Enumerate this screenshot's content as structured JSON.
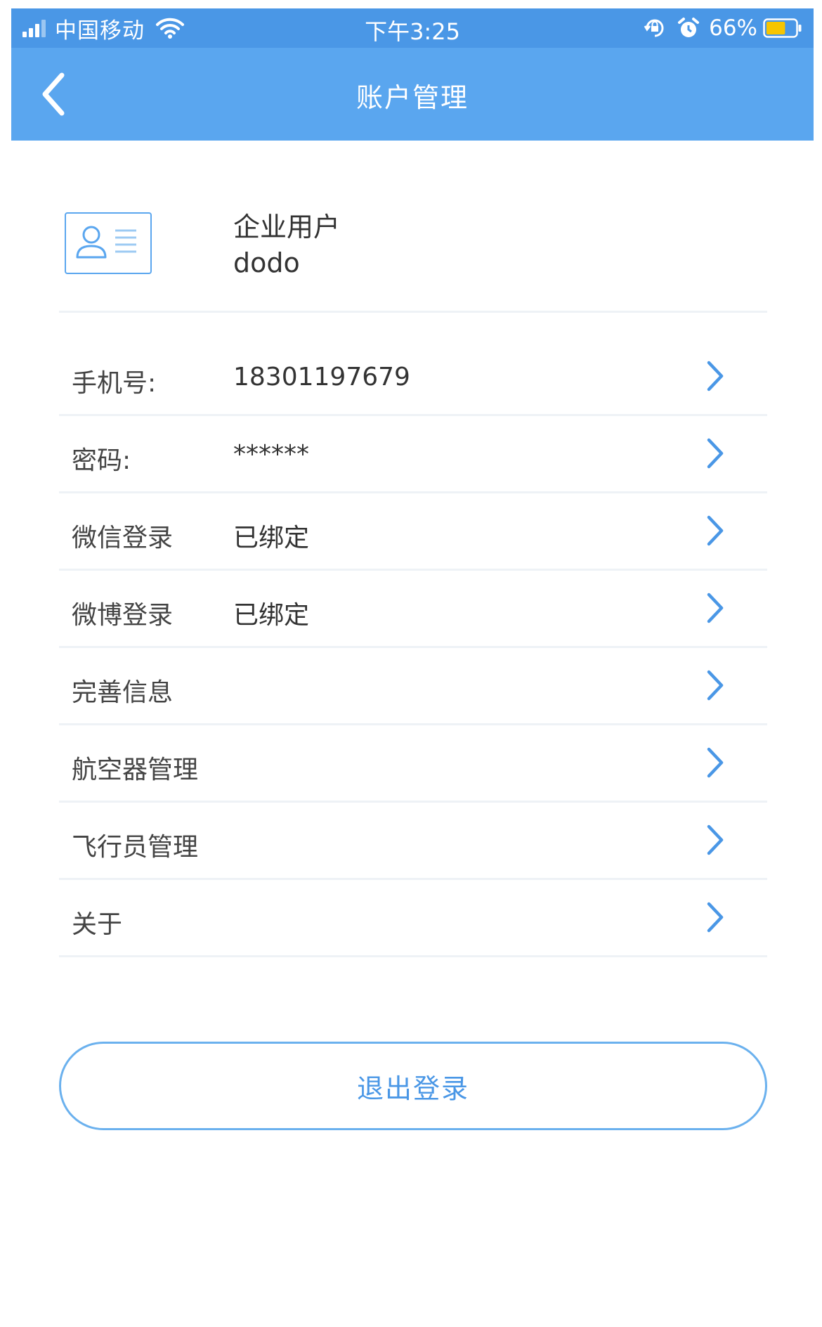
{
  "status_bar": {
    "carrier": "中国移动",
    "time": "下午3:25",
    "battery_percent": "66%",
    "battery_level": 0.66,
    "icons": [
      "signal-icon",
      "wifi-icon",
      "rotation-lock-icon",
      "alarm-icon",
      "battery-icon"
    ]
  },
  "nav": {
    "title": "账户管理",
    "back_icon": "chevron-left-icon"
  },
  "profile": {
    "icon": "id-card-icon",
    "user_type": "企业用户",
    "user_name": "dodo"
  },
  "rows": [
    {
      "label": "手机号:",
      "value": "18301197679"
    },
    {
      "label": "密码:",
      "value": "******"
    },
    {
      "label": "微信登录",
      "value": "已绑定"
    },
    {
      "label": "微博登录",
      "value": "已绑定"
    },
    {
      "label": "完善信息",
      "value": ""
    },
    {
      "label": "航空器管理",
      "value": ""
    },
    {
      "label": "飞行员管理",
      "value": ""
    },
    {
      "label": "关于",
      "value": ""
    }
  ],
  "logout": {
    "label": "退出登录"
  },
  "colors": {
    "status_bar": "#4a97e6",
    "nav_bar": "#5aa6ef",
    "accent": "#4a97e6",
    "divider": "#eef2f6"
  }
}
